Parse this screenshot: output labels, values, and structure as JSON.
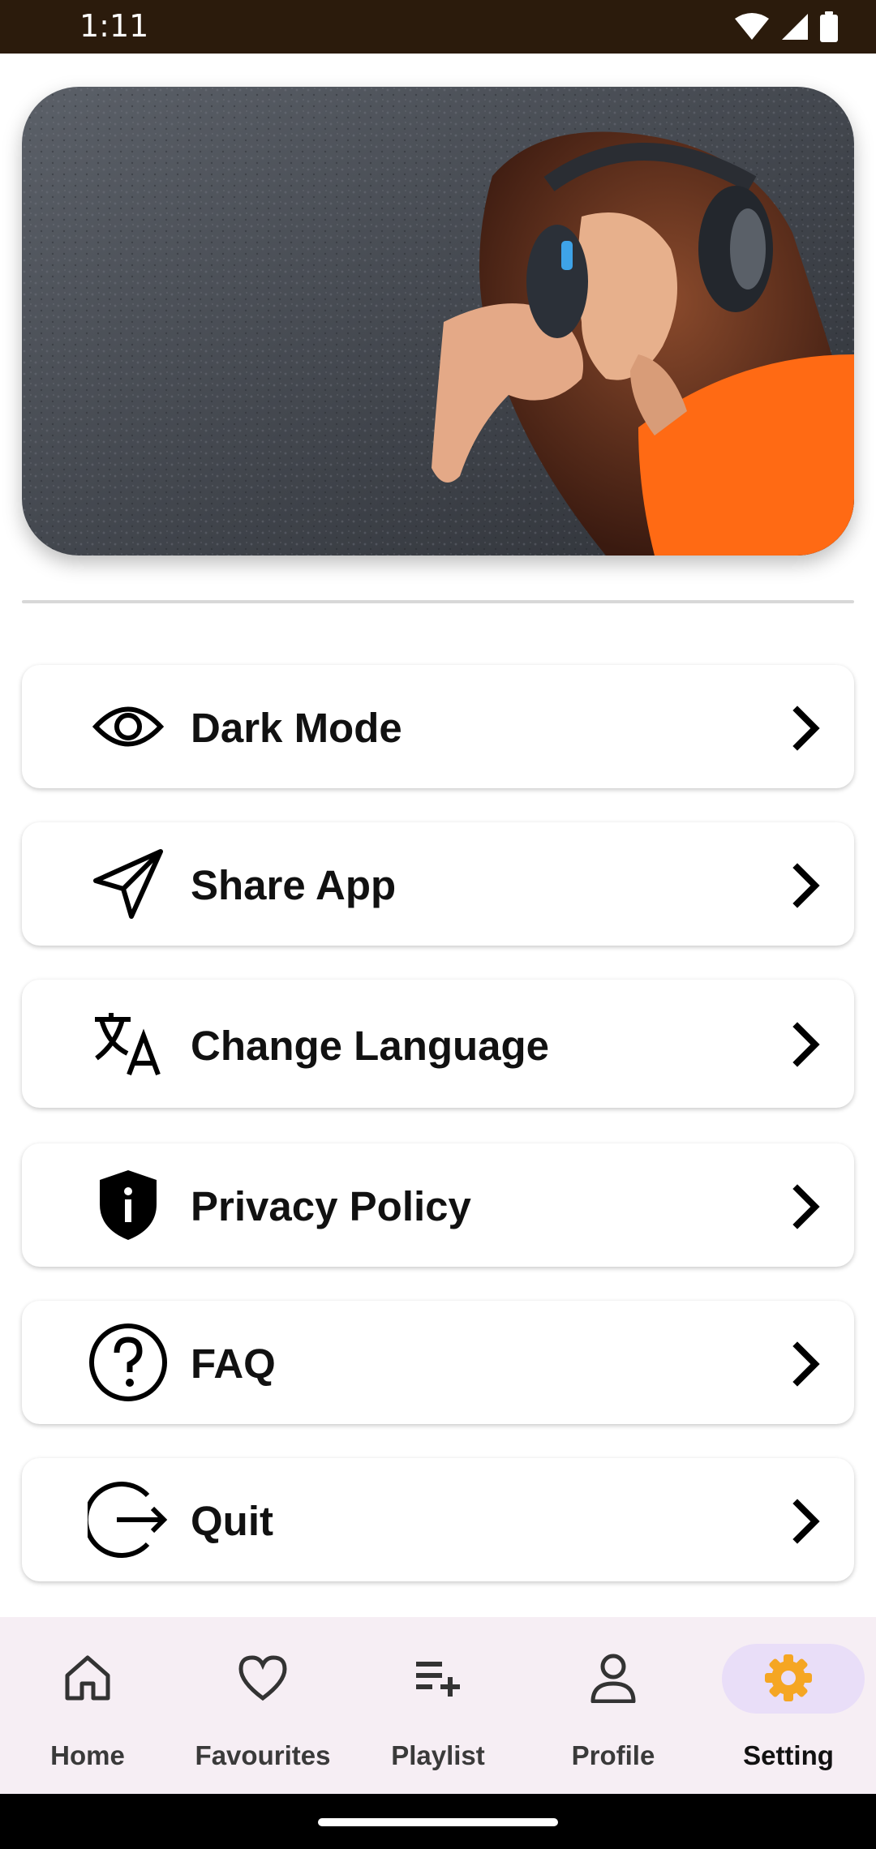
{
  "status_bar": {
    "time": "1:11",
    "icons": [
      "wifi-icon",
      "signal-icon",
      "battery-icon"
    ]
  },
  "hero": {
    "icon": "headphones-image"
  },
  "menu": [
    {
      "label": "Dark Mode",
      "icon": "eye-icon"
    },
    {
      "label": "Share App",
      "icon": "send-icon"
    },
    {
      "label": "Change Language",
      "icon": "translate-icon"
    },
    {
      "label": "Privacy Policy",
      "icon": "shield-icon"
    },
    {
      "label": "FAQ",
      "icon": "help-icon"
    },
    {
      "label": "Quit",
      "icon": "logout-icon"
    }
  ],
  "bottom_nav": [
    {
      "label": "Home",
      "icon": "home-icon"
    },
    {
      "label": "Favourites",
      "icon": "heart-icon"
    },
    {
      "label": "Playlist",
      "icon": "playlist-add-icon"
    },
    {
      "label": "Profile",
      "icon": "person-icon"
    },
    {
      "label": "Setting",
      "icon": "gear-icon",
      "active": true
    }
  ],
  "colors": {
    "status_bar": "#2b1b0c",
    "nav_background": "#f6eef4",
    "active_pill": "#e9def8",
    "active_icon": "#f5a623"
  }
}
